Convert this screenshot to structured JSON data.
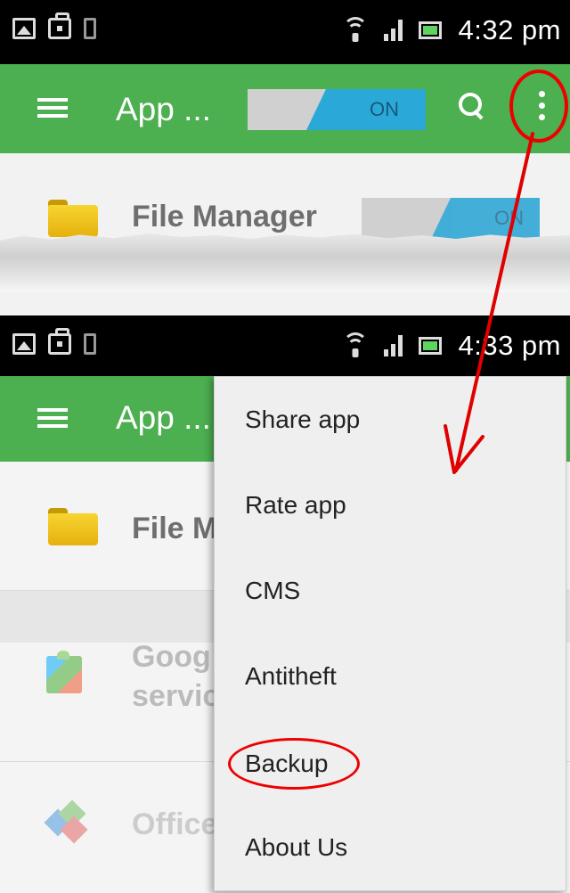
{
  "top_screen": {
    "status_bar": {
      "time": "4:32 pm"
    },
    "app_bar": {
      "title": "App ...",
      "toggle_label": "ON"
    },
    "row": {
      "title": "File Manager",
      "toggle_label": "ON"
    }
  },
  "bottom_screen": {
    "status_bar": {
      "time": "4:33 pm"
    },
    "app_bar": {
      "title": "App ..."
    },
    "rows": [
      {
        "title": "File M",
        "icon": "folder-icon"
      },
      {
        "title_line1": "Goog",
        "title_line2": "servic",
        "icon": "puzzle-icon"
      },
      {
        "title": "Office",
        "icon": "office-icon"
      }
    ],
    "menu": {
      "items": [
        "Share app",
        "Rate app",
        "CMS",
        "Antitheft",
        "Backup",
        "About Us"
      ]
    }
  },
  "colors": {
    "app_bar": "#4caf50",
    "toggle_on": "#2aa9d9",
    "annotation": "#e00000",
    "menu_bg": "#efefef"
  }
}
